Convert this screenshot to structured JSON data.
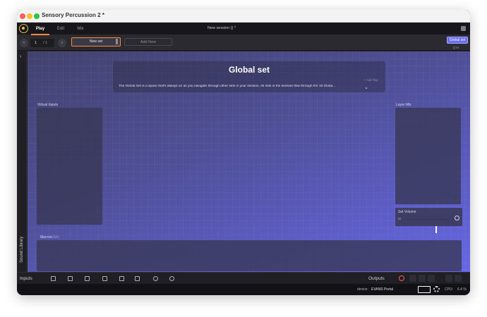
{
  "window": {
    "title": "Sensory Percussion 2 *"
  },
  "tabs": [
    {
      "label": "Play"
    },
    {
      "label": "Edit"
    },
    {
      "label": "Mix"
    }
  ],
  "session": {
    "name": "New session {} *"
  },
  "set_navigation": {
    "current_page": "1",
    "total_pages": "/ 1",
    "current_set": "New set",
    "add_new_label": "Add New",
    "global_set_button": "Global set",
    "mini_icons": "||| M"
  },
  "sidebar": {
    "sound_library_label": "Sound Library"
  },
  "global_set": {
    "title": "Global set",
    "add_tag": "+ Add Tag",
    "description": "The Global Set is a space that's always on as you navigate through other sets in your session. All sets in the session flow through the 16 Globa..."
  },
  "panels": {
    "virtual_inputs_label": "Virtual Inputs",
    "layer_mix_label": "Layer Mix",
    "set_volume_label": "Set Volume",
    "set_volume_m": "M",
    "set_volume_level": 0.7,
    "macros_label": "Macros",
    "macros_scope": "(Set)"
  },
  "bottombar": {
    "inputs_label": "Inputs",
    "outputs_label": "Outputs"
  },
  "statusbar": {
    "device_label": "device:",
    "device_name": "EVANS Portal",
    "cpu_label": "CPU:",
    "cpu_value": "6.4 %"
  },
  "colors": {
    "accent": "#ff8a3d",
    "global_button": "#6a6aff",
    "record": "#ff5a5a"
  }
}
